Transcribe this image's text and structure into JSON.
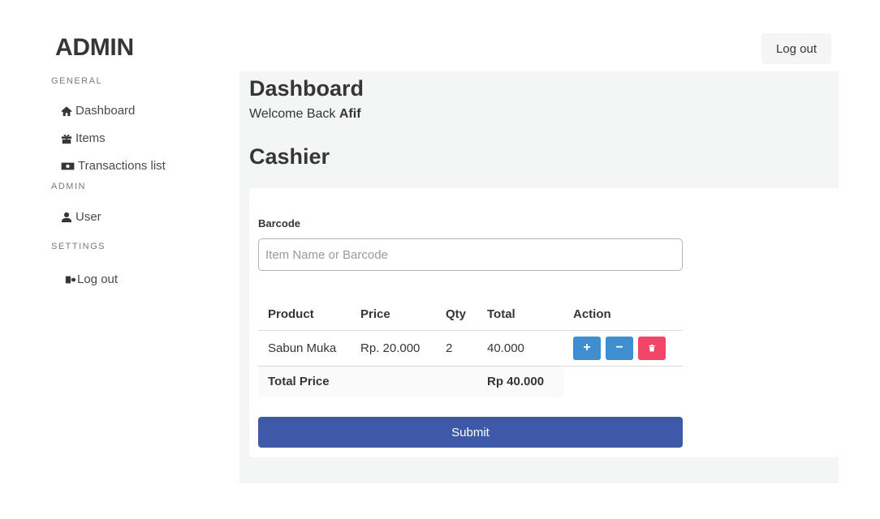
{
  "header": {
    "brand": "ADMIN",
    "logout_label": "Log out"
  },
  "sidebar": {
    "sections": [
      {
        "label": "GENERAL",
        "items": [
          {
            "label": "Dashboard",
            "icon": "home-icon"
          },
          {
            "label": "Items",
            "icon": "gift-icon"
          },
          {
            "label": "Transactions list",
            "icon": "money-bill-icon"
          }
        ]
      },
      {
        "label": "ADMIN",
        "items": [
          {
            "label": "User",
            "icon": "user-icon"
          }
        ]
      },
      {
        "label": "SETTINGS",
        "items": [
          {
            "label": "Log out",
            "icon": "sign-out-icon"
          }
        ]
      }
    ]
  },
  "main": {
    "title": "Dashboard",
    "welcome_prefix": "Welcome Back",
    "welcome_name": "Afif",
    "section_title": "Cashier",
    "barcode": {
      "label": "Barcode",
      "placeholder": "Item Name or Barcode",
      "value": ""
    },
    "table": {
      "headers": [
        "Product",
        "Price",
        "Qty",
        "Total",
        "Action"
      ],
      "rows": [
        {
          "product": "Sabun Muka",
          "price": "Rp. 20.000",
          "qty": "2",
          "total": "40.000"
        }
      ],
      "actions": {
        "increase": "+",
        "decrease": "−"
      },
      "total_label": "Total Price",
      "total_value": "Rp 40.000"
    },
    "submit_label": "Submit"
  },
  "colors": {
    "primary": "#3f59a9",
    "info": "#3e8ed0",
    "danger": "#f14668",
    "background": "#f4f5f5"
  }
}
